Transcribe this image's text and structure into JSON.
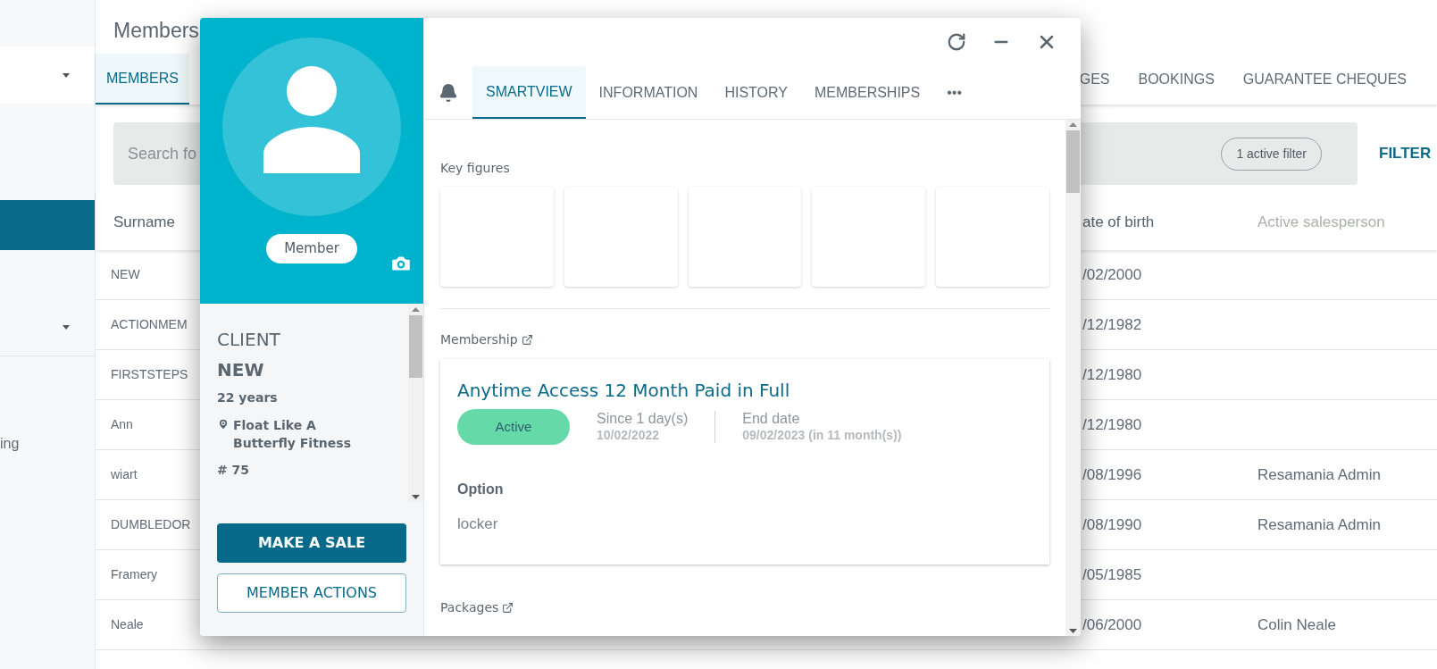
{
  "sidebar": {
    "items": [
      {
        "kind": "dropdown",
        "selected": false
      },
      {
        "kind": "item",
        "selected": true
      },
      {
        "kind": "dropdown",
        "selected": false
      },
      {
        "kind": "item",
        "label": "ing",
        "selected": false
      }
    ]
  },
  "page": {
    "title": "Members",
    "tabs": [
      {
        "label": "MEMBERS",
        "selected": true
      },
      {
        "label": "GES",
        "selected": false
      },
      {
        "label": "BOOKINGS",
        "selected": false
      },
      {
        "label": "GUARANTEE CHEQUES",
        "selected": false
      }
    ],
    "search": {
      "placeholder": "Search fo",
      "filter_chip": "1 active filter",
      "filter_button": "FILTER"
    },
    "table": {
      "columns": [
        "Surname",
        "ate of birth",
        "Active salesperson"
      ],
      "rows": [
        {
          "surname": "NEW",
          "date_of_birth": "/02/2000"
        },
        {
          "surname": "ACTIONMEM",
          "date_of_birth": "/12/1982"
        },
        {
          "surname": "FIRSTSTEPS",
          "date_of_birth": "/12/1980"
        },
        {
          "surname": "Ann",
          "date_of_birth": "/12/1980"
        },
        {
          "surname": "wiart",
          "date_of_birth": "/08/1996",
          "salesperson": "Resamania Admin"
        },
        {
          "surname": "DUMBLEDOR",
          "date_of_birth": "/08/1990",
          "salesperson": "Resamania Admin"
        },
        {
          "surname": "Framery",
          "date_of_birth": "/05/1985"
        },
        {
          "surname": "Neale",
          "date_of_birth": "/06/2000",
          "salesperson": "Colin Neale"
        }
      ]
    }
  },
  "member_panel": {
    "badge": "Member",
    "type": "CLIENT",
    "name": "NEW",
    "age": "22 years",
    "location": "Float Like A Butterfly Fitness",
    "number": "# 75",
    "buttons": [
      {
        "label": "MAKE A SALE",
        "kind": "primary"
      },
      {
        "label": "MEMBER ACTIONS",
        "kind": "outline"
      }
    ]
  },
  "detail": {
    "tabs": [
      {
        "label": "SMARTVIEW",
        "selected": true
      },
      {
        "label": "INFORMATION",
        "selected": false
      },
      {
        "label": "HISTORY",
        "selected": false
      },
      {
        "label": "MEMBERSHIPS",
        "selected": false
      },
      {
        "label": "•••",
        "selected": false
      }
    ],
    "key_figures": {
      "title": "Key figures",
      "cards": [
        {
          "kind": "blank"
        },
        {
          "kind": "blank"
        },
        {
          "kind": "blank"
        },
        {
          "kind": "blank"
        },
        {
          "kind": "blank"
        }
      ]
    },
    "membership": {
      "title": "Membership",
      "plan": "Anytime Access 12 Month Paid in Full",
      "status": "Active",
      "since_label": "Since 1 day(s)",
      "since_date": "10/02/2022",
      "end_label": "End date",
      "end_date": "09/02/2023 (in 11 month(s))",
      "option_label": "Option",
      "option": "locker"
    },
    "packages": {
      "title": "Packages"
    }
  }
}
